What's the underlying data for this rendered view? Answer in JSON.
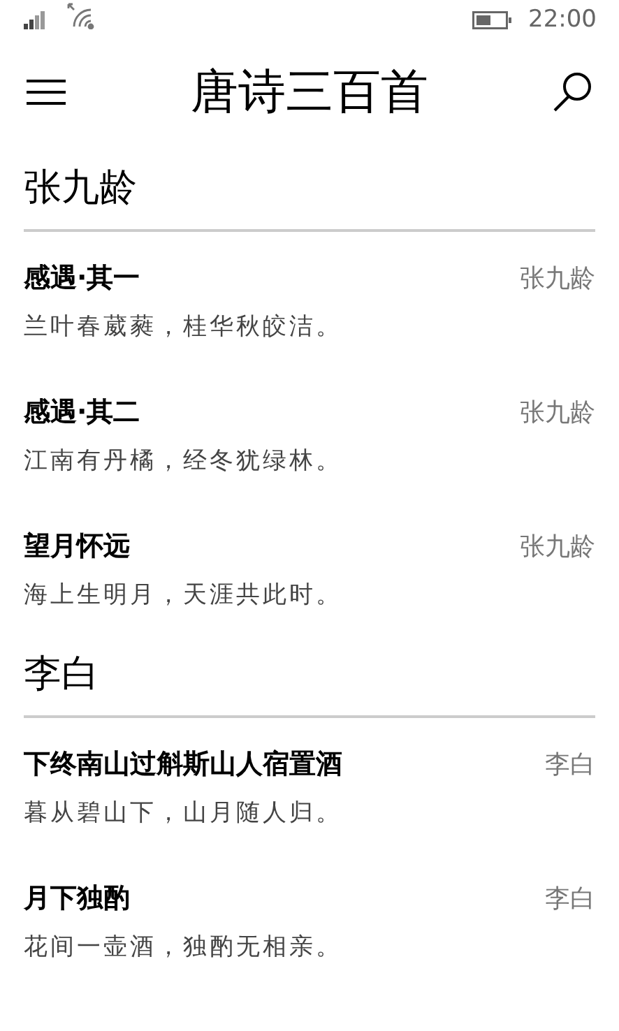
{
  "status_bar": {
    "time": "22:00"
  },
  "header": {
    "title": "唐诗三百首"
  },
  "sections": [
    {
      "author": "张九龄",
      "poems": [
        {
          "title": "感遇·其一",
          "line": "兰叶春葳蕤，桂华秋皎洁。",
          "author": "张九龄"
        },
        {
          "title": "感遇·其二",
          "line": "江南有丹橘，经冬犹绿林。",
          "author": "张九龄"
        },
        {
          "title": "望月怀远",
          "line": "海上生明月，天涯共此时。",
          "author": "张九龄"
        }
      ]
    },
    {
      "author": "李白",
      "poems": [
        {
          "title": "下终南山过斛斯山人宿置酒",
          "line": "暮从碧山下，山月随人归。",
          "author": "李白"
        },
        {
          "title": "月下独酌",
          "line": "花间一壶酒，独酌无相亲。",
          "author": "李白"
        }
      ]
    }
  ]
}
